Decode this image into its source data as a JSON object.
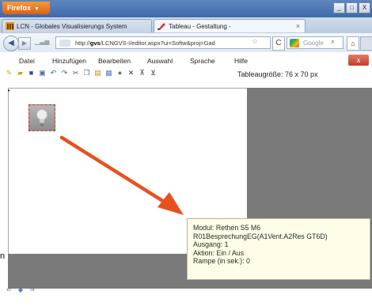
{
  "browser": {
    "menu_button": "Firefox",
    "window_buttons": [
      "_",
      "□",
      "X"
    ],
    "tabs": [
      {
        "label": "LCN - Globales Visualisierungs System"
      },
      {
        "label": "Tableau - Gestaltung -"
      }
    ],
    "new_tab": "+",
    "url": "http://gvs/LCNGVS-I/editor.aspx?ui=Softw&proj=Gad",
    "url_host": "gvs",
    "search_placeholder": "Google"
  },
  "app": {
    "menu": [
      "Datei",
      "Hinzufügen",
      "Bearbeiten",
      "Auswahl",
      "Sprache",
      "Hilfe"
    ],
    "close": "x",
    "table_size": "Tableaugröße: 76 x 70 px"
  },
  "tooltip": {
    "lines": [
      "Modul: Rethen S5 M6",
      "R01BesprechungEG(A1Vent.A2Res GT6D)",
      "Ausgang: 1",
      "Aktion: Ein / Aus",
      "Rampe (in sek.): 0"
    ]
  },
  "edge_text": "n",
  "nav_arrows": "⇐ ◆ ⇒",
  "colors": {
    "accent_orange": "#e8501e",
    "canvas_grey": "#7a7a7a",
    "tooltip_bg": "#fffde8",
    "titlebar_blue": "#4f78b4"
  }
}
